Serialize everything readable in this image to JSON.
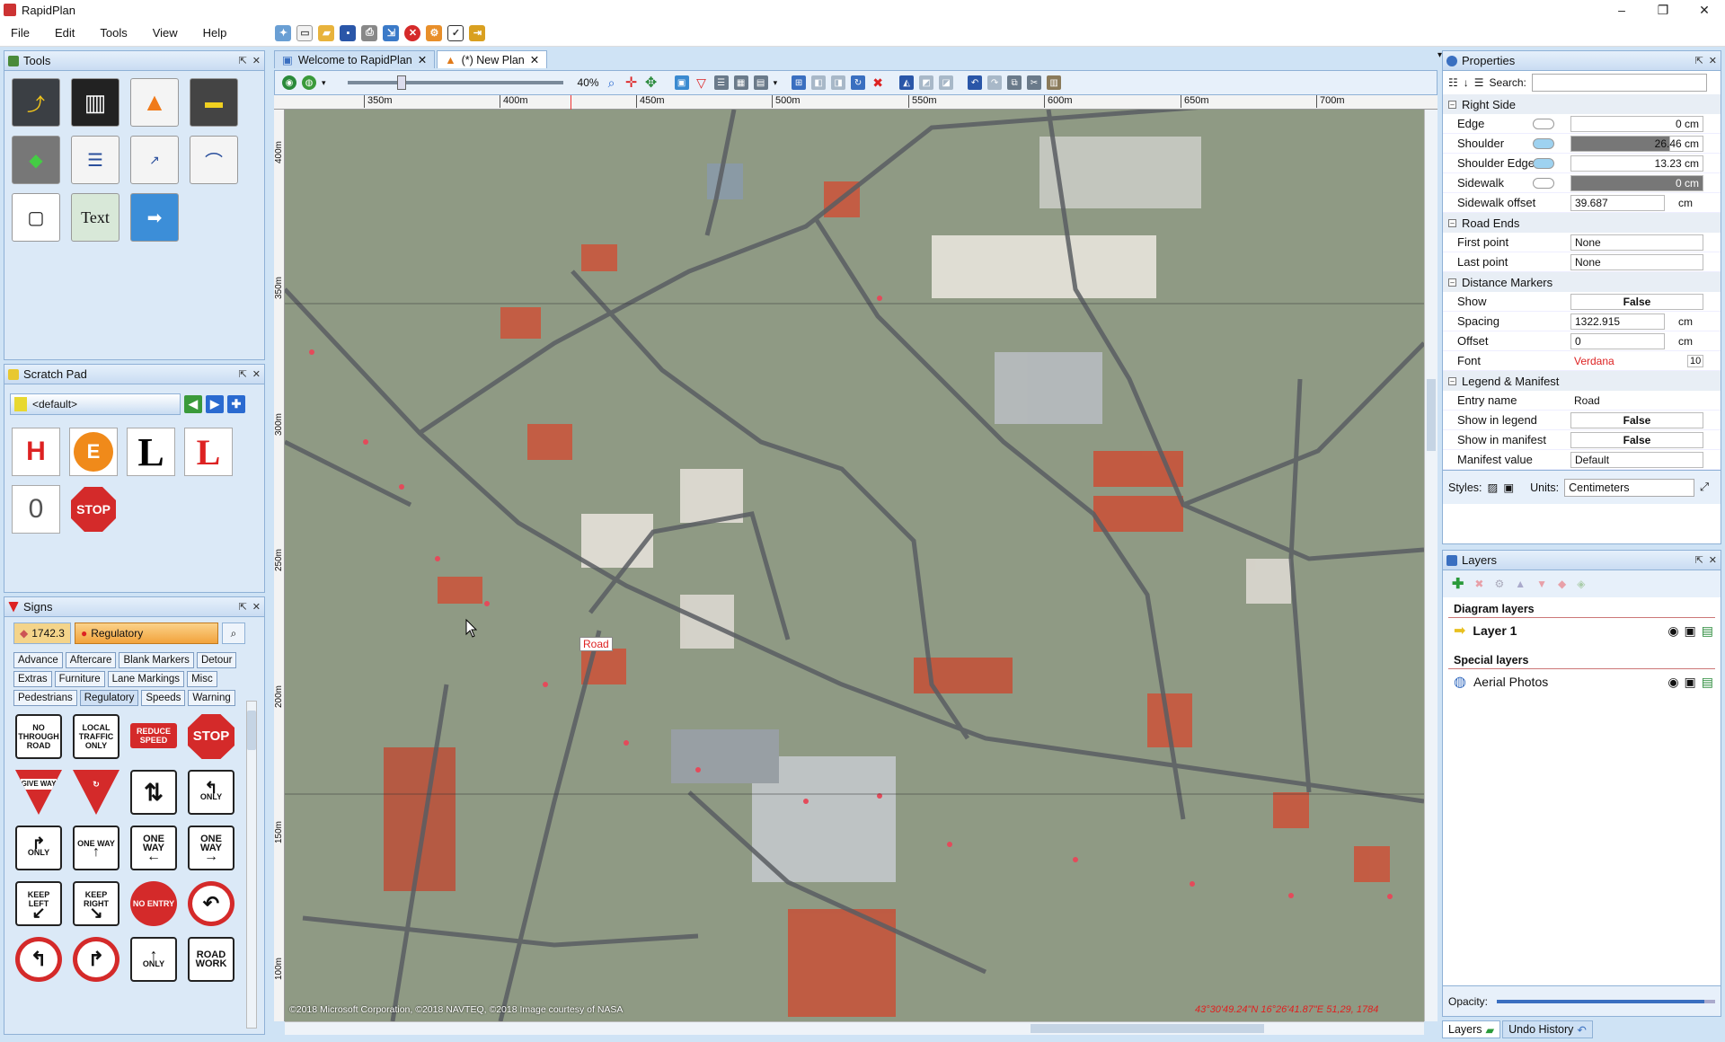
{
  "window": {
    "title": "RapidPlan",
    "buttons": [
      "–",
      "❐",
      "✕"
    ]
  },
  "menu": [
    "File",
    "Edit",
    "Tools",
    "View",
    "Help"
  ],
  "panels": {
    "tools": "Tools",
    "scratch": "Scratch Pad",
    "signs": "Signs",
    "properties": "Properties",
    "layers": "Layers"
  },
  "tools": {
    "text_tool_label": "Text"
  },
  "scratch": {
    "selected": "<default>",
    "signs": [
      "H",
      "E",
      "L",
      "L",
      "0",
      "STOP"
    ]
  },
  "signs": {
    "count": "1742.3",
    "category": "Regulatory",
    "categories": [
      "Advance",
      "Aftercare",
      "Blank Markers",
      "Detour",
      "Extras",
      "Furniture",
      "Lane Markings",
      "Misc",
      "Pedestrians",
      "Regulatory",
      "Speeds",
      "Warning"
    ],
    "items": [
      "NO THROUGH ROAD",
      "LOCAL TRAFFIC ONLY",
      "REDUCE SPEED",
      "STOP",
      "GIVE WAY",
      "",
      "",
      "ONLY",
      "ONLY",
      "ONE WAY",
      "ONE WAY",
      "ONE WAY",
      "KEEP LEFT",
      "KEEP RIGHT",
      "NO ENTRY",
      "",
      "",
      "",
      "ONLY",
      "ROAD WORK"
    ]
  },
  "doc_tabs": [
    "Welcome to RapidPlan",
    "(*) New Plan"
  ],
  "toolbar": {
    "zoom": "40%"
  },
  "ruler": {
    "h": [
      "350m",
      "400m",
      "450m",
      "500m",
      "550m",
      "600m",
      "650m",
      "700m"
    ],
    "v": [
      "400m",
      "350m",
      "300m",
      "250m",
      "200m",
      "150m",
      "100m"
    ]
  },
  "map": {
    "tooltip": "Road",
    "copyright": "©2018 Microsoft Corporation, ©2018 NAVTEQ, ©2018 Image courtesy of NASA",
    "coords": "43°30'49.24\"N 16°26'41.87\"E   51,29, 1784"
  },
  "properties": {
    "search_label": "Search:",
    "sections": {
      "right_side": "Right Side",
      "road_ends": "Road Ends",
      "distance_markers": "Distance Markers",
      "legend": "Legend & Manifest"
    },
    "rows": {
      "edge": {
        "name": "Edge",
        "value": "0 cm"
      },
      "shoulder": {
        "name": "Shoulder",
        "value": "26.46 cm"
      },
      "shoulder_edge": {
        "name": "Shoulder Edge",
        "value": "13.23 cm"
      },
      "sidewalk": {
        "name": "Sidewalk",
        "value": "0 cm"
      },
      "sidewalk_offset": {
        "name": "Sidewalk offset",
        "value": "39.687",
        "unit": "cm"
      },
      "first_point": {
        "name": "First point",
        "value": "None"
      },
      "last_point": {
        "name": "Last point",
        "value": "None"
      },
      "show": {
        "name": "Show",
        "value": "False"
      },
      "spacing": {
        "name": "Spacing",
        "value": "1322.915",
        "unit": "cm"
      },
      "offset": {
        "name": "Offset",
        "value": "0",
        "unit": "cm"
      },
      "font": {
        "name": "Font",
        "value": "Verdana",
        "size": "10"
      },
      "entry_name": {
        "name": "Entry name",
        "value": "Road"
      },
      "show_legend": {
        "name": "Show in legend",
        "value": "False"
      },
      "show_manifest": {
        "name": "Show in manifest",
        "value": "False"
      },
      "manifest_value": {
        "name": "Manifest value",
        "value": "Default"
      }
    },
    "styles_label": "Styles:",
    "units_label": "Units:",
    "units_value": "Centimeters"
  },
  "layers": {
    "diagram_heading": "Diagram layers",
    "layer1": "Layer 1",
    "special_heading": "Special layers",
    "aerial": "Aerial Photos",
    "opacity_label": "Opacity:",
    "opacity": 0.95
  },
  "bottom_tabs": [
    "Layers",
    "Undo History"
  ]
}
